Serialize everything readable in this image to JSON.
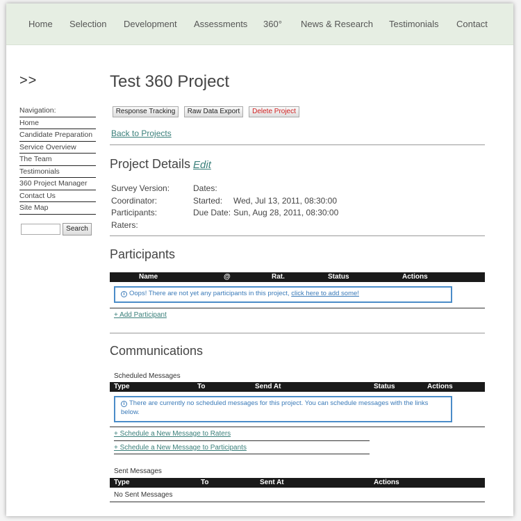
{
  "nav": {
    "items": [
      "Home",
      "Selection",
      "Development",
      "Assessments",
      "360°",
      "News & Research",
      "Testimonials",
      "Contact"
    ]
  },
  "sidebar": {
    "logo": ">>",
    "heading": "Navigation:",
    "items": [
      "Home",
      "Candidate Preparation",
      "Service Overview",
      "The Team",
      "Testimonials",
      "360 Project Manager",
      "Contact Us",
      "Site Map"
    ],
    "search_value": "",
    "search_button": "Search"
  },
  "main": {
    "title": "Test 360 Project",
    "buttons": {
      "response_tracking": "Response Tracking",
      "raw_data_export": "Raw Data Export",
      "delete_project": "Delete Project"
    },
    "back_link": "Back to Projects",
    "details": {
      "heading": "Project Details",
      "edit": "Edit",
      "survey_version_label": "Survey Version:",
      "coordinator_label": "Coordinator:",
      "participants_label": "Participants:",
      "raters_label": "Raters:",
      "dates_label": "Dates:",
      "started_label": "Started:",
      "started_value": "Wed, Jul 13, 2011, 08:30:00",
      "due_label": "Due Date:",
      "due_value": "Sun, Aug 28, 2011, 08:30:00"
    },
    "participants": {
      "heading": "Participants",
      "columns": [
        "Name",
        "@",
        "Rat.",
        "Status",
        "Actions"
      ],
      "notice_text": "Oops! There are not yet any participants in this project, ",
      "notice_link": "click here to add some!",
      "add_link": "+ Add Participant"
    },
    "communications": {
      "heading": "Communications",
      "scheduled_heading": "Scheduled Messages",
      "scheduled_columns": [
        "Type",
        "To",
        "Send At",
        "Status",
        "Actions"
      ],
      "scheduled_notice": "There are currently no scheduled messages for this project. You can schedule messages with the links below.",
      "schedule_raters_link": "+ Schedule a New Message to Raters",
      "schedule_participants_link": "+ Schedule a New Message to Participants",
      "sent_heading": "Sent Messages",
      "sent_columns": [
        "Type",
        "To",
        "Sent At",
        "Actions"
      ],
      "no_sent": "No Sent Messages"
    }
  },
  "colors": {
    "nav_bg": "#e6eee3",
    "link": "#3a7f7a",
    "notice_border": "#4a8cc8",
    "danger": "#d02020",
    "table_header": "#1a1a1a"
  }
}
